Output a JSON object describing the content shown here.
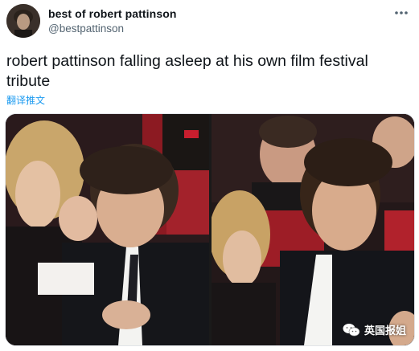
{
  "tweet": {
    "display_name": "best of robert pattinson",
    "handle": "@bestpattinson",
    "more_icon": "more-dots-icon",
    "text": "robert pattinson falling asleep at his own film festival tribute",
    "translate_label": "翻译推文"
  },
  "media": {
    "watermark_text": "英国报姐",
    "watermark_icon": "wechat-icon"
  },
  "colors": {
    "accent": "#1d9bf0",
    "secondary_text": "#536471",
    "primary_text": "#0f1419"
  }
}
